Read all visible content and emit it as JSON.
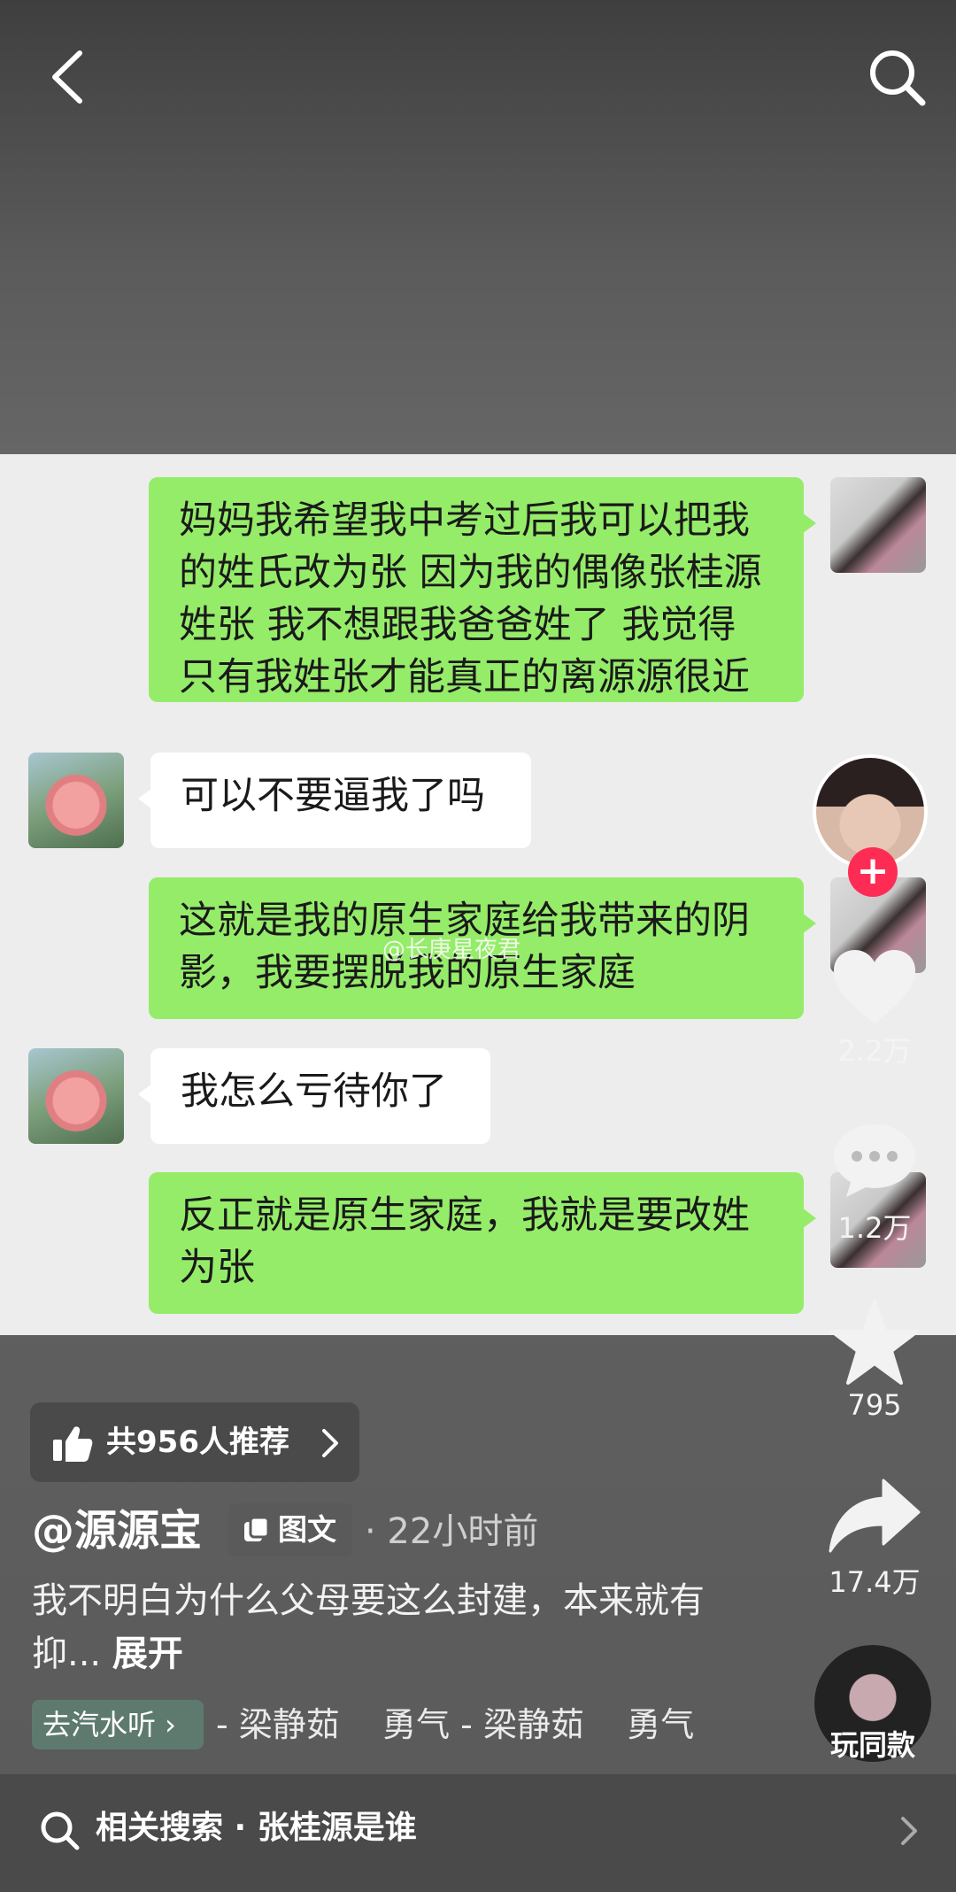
{
  "chat": {
    "messages": [
      {
        "side": "me",
        "text": "妈妈我希望我中考过后我可以把我\n的姓氏改为张 因为我的偶像张桂源\n姓张 我不想跟我爸爸姓了 我觉得\n只有我姓张才能真正的离源源很近"
      },
      {
        "side": "other",
        "text": "可以不要逼我了吗"
      },
      {
        "side": "me",
        "text": "这就是我的原生家庭给我带来的阴\n影，我要摆脱我的原生家庭"
      },
      {
        "side": "other",
        "text": "我怎么亏待你了"
      },
      {
        "side": "me",
        "text": "反正就是原生家庭，我就是要改姓\n为张"
      }
    ],
    "watermark": "@长庚星夜君"
  },
  "actions": {
    "follow_label": "+",
    "like_count": "2.2万",
    "comment_count": "1.2万",
    "favorite_count": "795",
    "share_count": "17.4万",
    "same_style_label": "玩同款"
  },
  "post": {
    "recommend_text": "共956人推荐",
    "author": "@源源宝",
    "type_tag": "图文",
    "time": "· 22小时前",
    "description": "我不明白为什么父母要这么封建，本来就有抑...",
    "expand_label": "展开",
    "music_pill": "去汽水听 ›",
    "music_text": "- 梁静茹    勇气 - 梁静茹    勇气"
  },
  "bottom": {
    "search_text": "相关搜索 · 张桂源是谁"
  },
  "icons": [
    "back-icon",
    "search-icon",
    "heart-icon",
    "comment-icon",
    "star-icon",
    "share-icon",
    "thumbs-up-icon",
    "chevron-right-icon",
    "image-text-icon"
  ],
  "colors": {
    "my_bubble": "#95ec69",
    "follow": "#fe2c55"
  }
}
